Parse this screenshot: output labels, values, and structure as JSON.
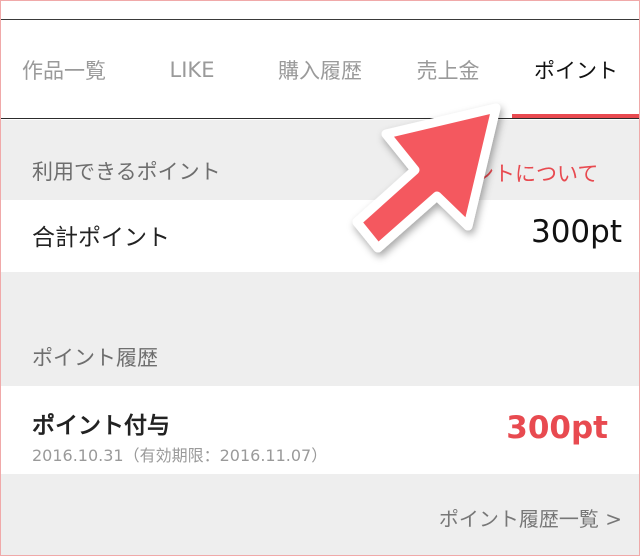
{
  "tabs": [
    {
      "label": "作品一覧",
      "active": false
    },
    {
      "label": "LIKE",
      "active": false
    },
    {
      "label": "購入履歴",
      "active": false
    },
    {
      "label": "売上金",
      "active": false
    },
    {
      "label": "ポイント",
      "active": true
    }
  ],
  "available": {
    "section_label": "利用できるポイント",
    "about_link": "ポイントについて"
  },
  "total": {
    "label": "合計ポイント",
    "value": "300pt"
  },
  "history": {
    "section_label": "ポイント履歴",
    "items": [
      {
        "title": "ポイント付与",
        "date": "2016.10.31（有効期限：2016.11.07）",
        "value": "300pt"
      }
    ],
    "more_link": "ポイント履歴一覧 >"
  },
  "overlay": {
    "icon": "arrow-up-right-icon",
    "color": "#f4585e"
  },
  "colors": {
    "accent": "#e84a50",
    "background": "#eeeeee"
  }
}
